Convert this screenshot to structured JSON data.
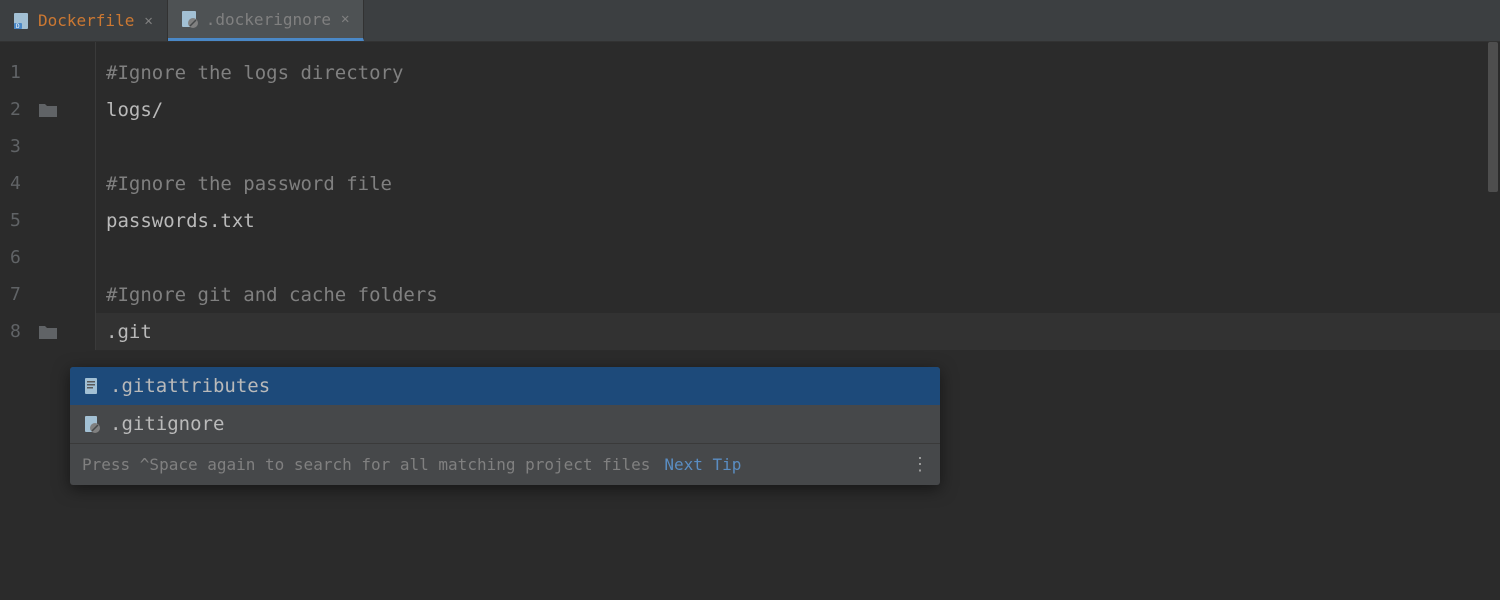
{
  "tabs": [
    {
      "label": "Dockerfile",
      "active": false,
      "color": "orange"
    },
    {
      "label": ".dockerignore",
      "active": true,
      "color": "grey"
    }
  ],
  "lines": [
    {
      "num": "1",
      "text": "#Ignore the logs directory",
      "type": "comment",
      "icon": null
    },
    {
      "num": "2",
      "text": "logs/",
      "type": "code",
      "icon": "folder"
    },
    {
      "num": "3",
      "text": "",
      "type": "blank",
      "icon": null
    },
    {
      "num": "4",
      "text": "#Ignore the password file",
      "type": "comment",
      "icon": null
    },
    {
      "num": "5",
      "text": "passwords.txt",
      "type": "code",
      "icon": null
    },
    {
      "num": "6",
      "text": "",
      "type": "blank",
      "icon": null
    },
    {
      "num": "7",
      "text": "#Ignore git and cache folders",
      "type": "comment",
      "icon": null
    },
    {
      "num": "8",
      "text": ".git",
      "type": "code",
      "icon": "folder",
      "current": true
    }
  ],
  "completion": {
    "items": [
      {
        "match": ".git",
        "rest": "attributes",
        "selected": true,
        "icon": "file"
      },
      {
        "match": ".git",
        "rest": "ignore",
        "selected": false,
        "icon": "file-ignore"
      }
    ],
    "hint": "Press ^Space again to search for all matching project files",
    "next_tip": "Next Tip"
  }
}
